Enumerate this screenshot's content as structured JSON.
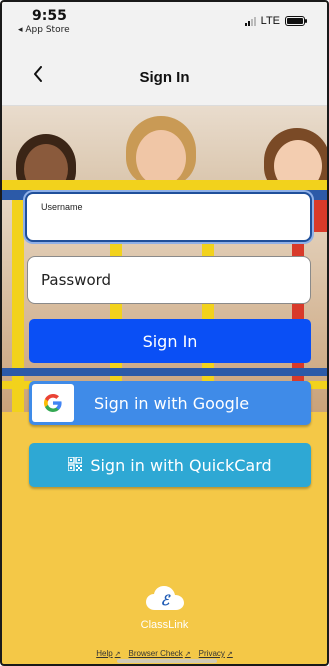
{
  "status_bar": {
    "time": "9:55",
    "back_app": "◂ App Store",
    "network": "LTE"
  },
  "nav": {
    "title": "Sign In"
  },
  "form": {
    "username_label": "Username",
    "username_value": "",
    "password_placeholder": "Password",
    "signin_label": "Sign In",
    "google_label": "Sign in with Google",
    "quickcard_label": "Sign in with QuickCard"
  },
  "footer": {
    "brand": "ClassLink",
    "links": [
      "Help",
      "Browser Check",
      "Privacy"
    ]
  },
  "colors": {
    "background": "#f4c847",
    "signin_button": "#0a4ff5",
    "google_button": "#3f8be8",
    "quickcard_button": "#2ea8d4",
    "focus_border": "#1f4f9a"
  },
  "icons": {
    "back": "chevron-left-icon",
    "google": "google-g-icon",
    "quickcard": "qr-code-icon",
    "logo": "classlink-cloud-icon",
    "external": "external-link-icon"
  }
}
